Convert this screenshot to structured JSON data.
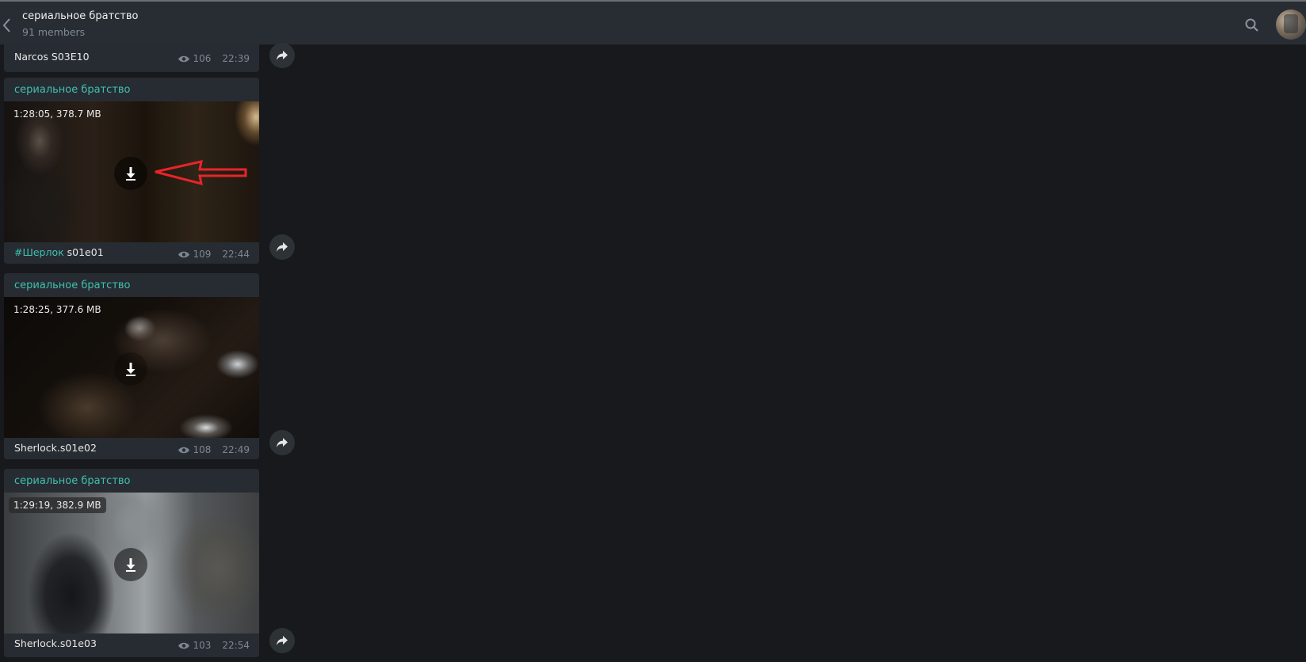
{
  "header": {
    "title": "сериальное братство",
    "subtitle": "91 members"
  },
  "top_message": {
    "caption": "Narcos S03E10",
    "views": "106",
    "time": "22:39"
  },
  "messages": [
    {
      "sender": "сериальное братство",
      "video_meta": "1:28:05, 378.7 MB",
      "caption_tag": "#Шерлок",
      "caption": " s01e01",
      "views": "109",
      "time": "22:44"
    },
    {
      "sender": "сериальное братство",
      "video_meta": "1:28:25, 377.6 MB",
      "caption_tag": "",
      "caption": "Sherlock.s01e02",
      "views": "108",
      "time": "22:49"
    },
    {
      "sender": "сериальное братство",
      "video_meta": "1:29:19, 382.9 MB",
      "caption_tag": "",
      "caption": "Sherlock.s01e03",
      "views": "103",
      "time": "22:54"
    }
  ],
  "colors": {
    "accent": "#3fc1b0",
    "background": "#17191d",
    "header": "#282d33",
    "bubble": "#272c32",
    "annotation_arrow": "#e8242b"
  },
  "icons": {
    "back": "back-chevron-icon",
    "search": "search-icon",
    "views": "eye-icon",
    "download": "download-arrow-icon",
    "share": "share-arrow-icon"
  }
}
